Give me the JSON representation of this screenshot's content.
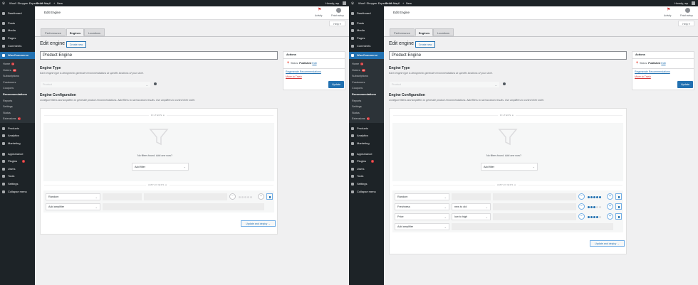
{
  "adminbar": {
    "site": "Woo!! Shopper Experience Map",
    "updates": "10",
    "comments": "0",
    "new": "New",
    "howdy": "Howdy, wp"
  },
  "sidebar": {
    "top": [
      {
        "label": "Dashboard"
      },
      {
        "label": "Posts"
      },
      {
        "label": "Media"
      },
      {
        "label": "Pages"
      },
      {
        "label": "Comments"
      }
    ],
    "woocommerce": "WooCommerce",
    "submenu": [
      {
        "label": "Home",
        "badge": "1"
      },
      {
        "label": "Orders",
        "badge": "28"
      },
      {
        "label": "Subscriptions"
      },
      {
        "label": "Customers"
      },
      {
        "label": "Coupons"
      },
      {
        "label": "Recommendations",
        "current": true
      },
      {
        "label": "Reports"
      },
      {
        "label": "Settings"
      },
      {
        "label": "Status"
      },
      {
        "label": "Extensions",
        "badge": "6"
      }
    ],
    "bottom": [
      {
        "label": "Products"
      },
      {
        "label": "Analytics"
      },
      {
        "label": "Marketing"
      },
      {
        "label": "Appearance"
      },
      {
        "label": "Plugins",
        "badge": "7"
      },
      {
        "label": "Users"
      },
      {
        "label": "Tools"
      },
      {
        "label": "Settings"
      },
      {
        "label": "Collapse menu"
      }
    ]
  },
  "header": {
    "title": "Edit Engine",
    "activity": "Activity",
    "finish_setup": "Finish setup",
    "help": "Help ▾"
  },
  "tabs": [
    "Performance",
    "Engines",
    "Locations"
  ],
  "page": {
    "heading": "Edit engine",
    "create_new": "Create new",
    "engine_name": "Product Engine"
  },
  "engine_type": {
    "title": "Engine Type",
    "description": "Each engine type is designed to generate recommendations at specific locations of your store.",
    "value": "Product"
  },
  "config": {
    "title": "Engine Configuration",
    "description": "Configure filters and amplifiers to generate product recommendations. Add filters to narrow down results. Use amplifiers to control their order.",
    "filters_label": "FILTERS",
    "no_filters": "No filters found. Add one now?",
    "add_filter": "Add filter",
    "amplifiers_label": "AMPLIFIERS",
    "add_amplifier": "Add amplifier",
    "update_deploy": "Update and deploy →"
  },
  "actions": {
    "title": "Actions",
    "status_label": "Status:",
    "status_value": "Published",
    "edit": "Edit",
    "regenerate": "Regenerate Recommendations",
    "trash": "Move to Trash",
    "update": "Update"
  },
  "panels": [
    {
      "amplifiers": [
        {
          "name": "Random",
          "order": "",
          "weight": 0
        }
      ]
    },
    {
      "amplifiers": [
        {
          "name": "Random",
          "order": "",
          "weight": 5
        },
        {
          "name": "Freshness",
          "order": "new to old",
          "weight": 3
        },
        {
          "name": "Price",
          "order": "low to high",
          "weight": 4
        }
      ]
    }
  ]
}
